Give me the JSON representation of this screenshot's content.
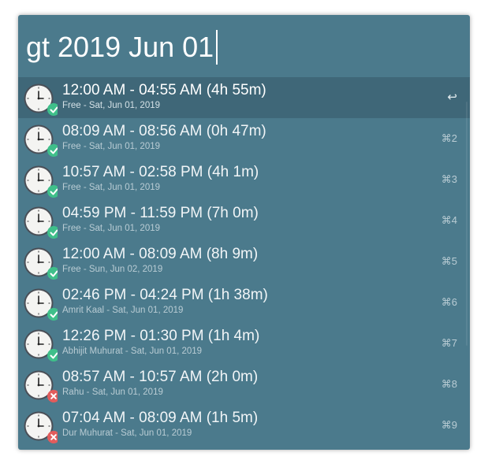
{
  "search": {
    "query": "gt 2019 Jun 01"
  },
  "colors": {
    "window_bg": "#4b7a8c",
    "selected_bg": "#3f6778",
    "badge_green": "#3fbf8a",
    "badge_red": "#e25c5c"
  },
  "results": [
    {
      "title": "12:00 AM - 04:55 AM (4h 55m)",
      "subtitle": "Free - Sat, Jun 01, 2019",
      "shortcut": "↩",
      "status": "ok",
      "icon": "clock-icon"
    },
    {
      "title": "08:09 AM - 08:56 AM (0h 47m)",
      "subtitle": "Free - Sat, Jun 01, 2019",
      "shortcut": "⌘2",
      "status": "ok",
      "icon": "clock-icon"
    },
    {
      "title": "10:57 AM - 02:58 PM (4h 1m)",
      "subtitle": "Free - Sat, Jun 01, 2019",
      "shortcut": "⌘3",
      "status": "ok",
      "icon": "clock-icon"
    },
    {
      "title": "04:59 PM - 11:59 PM (7h 0m)",
      "subtitle": "Free - Sat, Jun 01, 2019",
      "shortcut": "⌘4",
      "status": "ok",
      "icon": "clock-icon"
    },
    {
      "title": "12:00 AM - 08:09 AM (8h 9m)",
      "subtitle": "Free - Sun, Jun 02, 2019",
      "shortcut": "⌘5",
      "status": "ok",
      "icon": "clock-icon"
    },
    {
      "title": "02:46 PM - 04:24 PM (1h 38m)",
      "subtitle": "Amrit Kaal - Sat, Jun 01, 2019",
      "shortcut": "⌘6",
      "status": "ok",
      "icon": "clock-icon"
    },
    {
      "title": "12:26 PM - 01:30 PM (1h 4m)",
      "subtitle": "Abhijit Muhurat - Sat, Jun 01, 2019",
      "shortcut": "⌘7",
      "status": "ok",
      "icon": "clock-icon"
    },
    {
      "title": "08:57 AM - 10:57 AM (2h 0m)",
      "subtitle": "Rahu - Sat, Jun 01, 2019",
      "shortcut": "⌘8",
      "status": "bad",
      "icon": "clock-icon"
    },
    {
      "title": "07:04 AM - 08:09 AM (1h 5m)",
      "subtitle": "Dur Muhurat - Sat, Jun 01, 2019",
      "shortcut": "⌘9",
      "status": "bad",
      "icon": "clock-icon"
    }
  ]
}
